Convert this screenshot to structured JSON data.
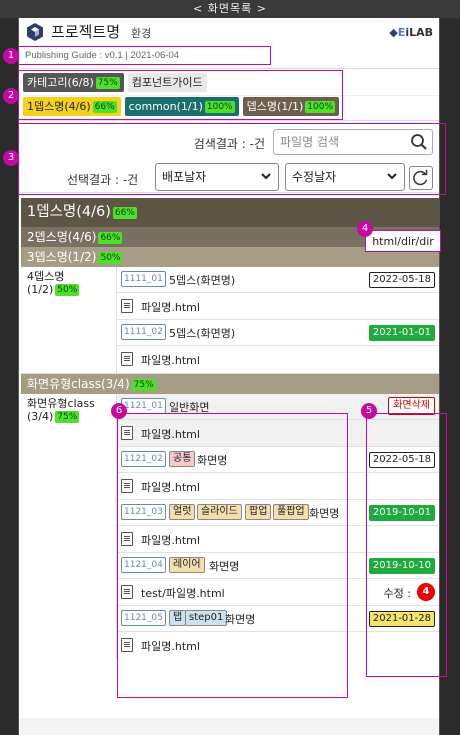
{
  "topbar": {
    "label": "< 화면목록 >"
  },
  "header": {
    "title": "프로젝트명",
    "subtitle": "환경",
    "brand_e": "E",
    "brand_rest": "iLAB"
  },
  "guide": {
    "text": "Publishing Guide : v0.1 | 2021-06-04"
  },
  "tabs_row1": [
    {
      "label": "카테고리(6/8)",
      "pct": "75%"
    },
    {
      "label": "컴포넌트가이드",
      "pct": ""
    }
  ],
  "tabs_row2": [
    {
      "label": "1뎁스명(4/6)",
      "pct": "66%"
    },
    {
      "label": "common(1/1)",
      "pct": "100%"
    },
    {
      "label": "뎁스명(1/1)",
      "pct": "100%"
    }
  ],
  "search": {
    "result_label": "검색결과 : -건",
    "placeholder": "파일명 검색",
    "select_label": "선택결과 : -건",
    "select1": "배포날자",
    "select2": "수정날자"
  },
  "list": {
    "h1": {
      "label": "1뎁스명(4/6)",
      "pct": "66%"
    },
    "h2": {
      "label": "2뎁스명(4/6)",
      "pct": "66%",
      "dir": "html/dir/dir"
    },
    "h3": {
      "label": "3뎁스명(1/2)",
      "pct": "50%"
    },
    "group1": {
      "label_line1": "4뎁스명",
      "label_line2": "(1/2)",
      "pct": "50%",
      "rows": [
        {
          "code": "1111_01",
          "title": "5뎁스(화면명)",
          "date": "2022-05-18",
          "file": "파일명.html"
        },
        {
          "code": "1111_02",
          "title": "5뎁스(화면명)",
          "date": "2021-01-01",
          "file": "파일명.html"
        }
      ]
    },
    "class_header": {
      "label": "화면유형class(3/4)",
      "pct": "75%"
    },
    "group2": {
      "label_line1": "화면유형class",
      "label_line2": "(3/4)",
      "pct": "75%",
      "rows": [
        {
          "code": "1121_01",
          "title": "일반화면",
          "action": "화면삭제",
          "file": "파일명.html"
        },
        {
          "code": "1121_02",
          "tags": [
            "공통"
          ],
          "title": "화면명",
          "date": "2022-05-18",
          "file": "파일명.html"
        },
        {
          "code": "1121_03",
          "tags": [
            "얼럿",
            "슬라이드",
            "팝업",
            "풀팝업"
          ],
          "title": "화면명",
          "date": "2019-10-01",
          "file": "파일명.html"
        },
        {
          "code": "1121_04",
          "tags": [
            "레이어"
          ],
          "title": "화면명",
          "date": "2019-10-10",
          "file": "test/파일명.html",
          "modified_label": "수정 :",
          "modified_count": "4"
        },
        {
          "code": "1121_05",
          "tags": [
            "탭",
            "step01"
          ],
          "title": "화면명",
          "date": "2021-01-28",
          "file": "파일명.html"
        }
      ]
    }
  },
  "annotations": [
    "1",
    "2",
    "3",
    "4",
    "5",
    "6"
  ]
}
